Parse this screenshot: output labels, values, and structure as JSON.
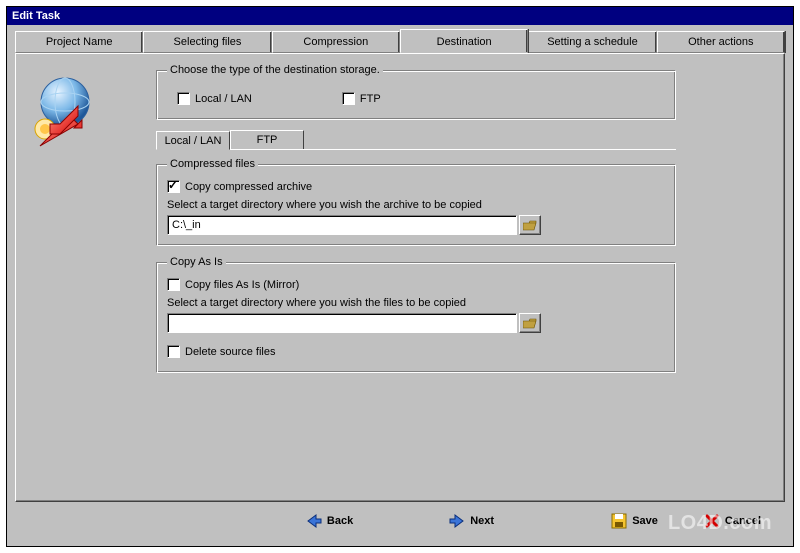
{
  "window": {
    "title": "Edit Task"
  },
  "tabs": {
    "project": "Project Name",
    "selecting": "Selecting files",
    "compression": "Compression",
    "destination": "Destination",
    "schedule": "Setting a schedule",
    "other": "Other actions"
  },
  "storage": {
    "legend": "Choose the type of the destination storage.",
    "local": "Local / LAN",
    "ftp": "FTP"
  },
  "subtabs": {
    "local": "Local / LAN",
    "ftp": "FTP"
  },
  "compressed": {
    "legend": "Compressed files",
    "copy_label": "Copy compressed archive",
    "desc": "Select a target directory where you wish the archive to be copied",
    "path": "C:\\_in"
  },
  "copyasis": {
    "legend": "Copy As Is",
    "copy_label": "Copy files As Is (Mirror)",
    "desc": "Select a target directory where you wish the files to be copied",
    "path": "",
    "delete_label": "Delete source files"
  },
  "buttons": {
    "back": "Back",
    "next": "Next",
    "save": "Save",
    "cancel": "Cancel"
  },
  "watermark": "LO4D.com"
}
